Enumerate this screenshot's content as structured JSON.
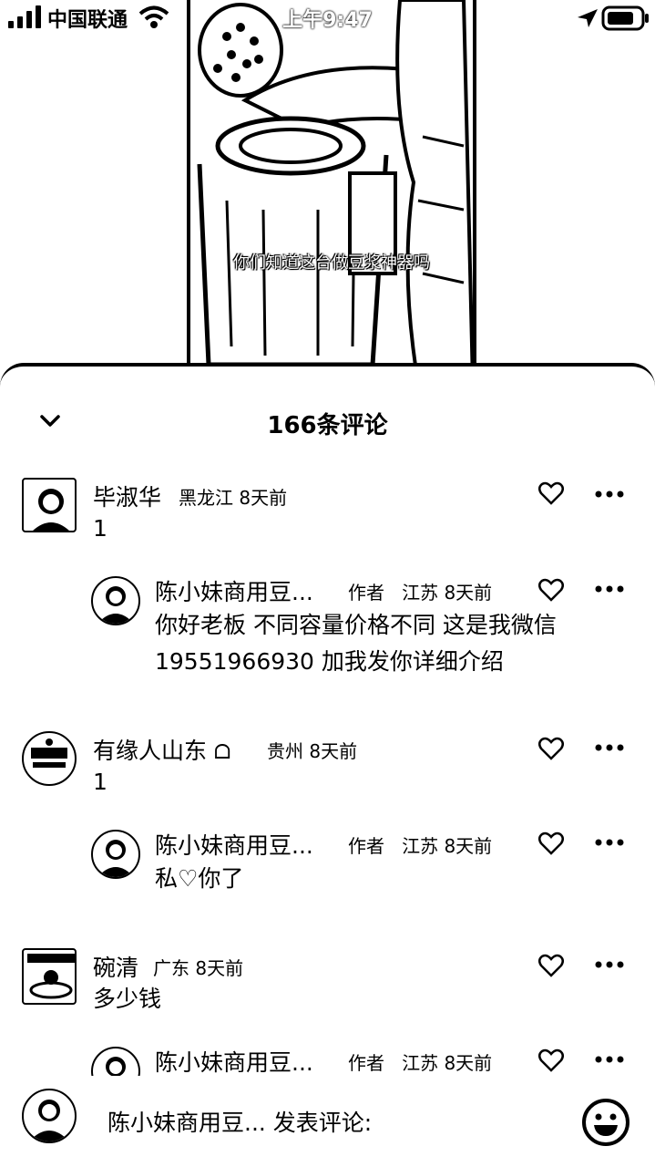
{
  "status_bar": {
    "carrier": "中国联通",
    "time": "上午9:47"
  },
  "video": {
    "caption": "你们知道这台做豆浆神器吗"
  },
  "sheet": {
    "title": "166条评论"
  },
  "comments": [
    {
      "name": "毕淑华",
      "location": "黑龙江",
      "time": "8天前",
      "text": "1",
      "reply": {
        "name": "陈小妹商用豆...",
        "tag": "作者",
        "location": "江苏",
        "time": "8天前",
        "text": "你好老板 不同容量价格不同 这是我微信\n19551966930  加我发你详细介绍"
      }
    },
    {
      "name": "有缘人山东",
      "badge": "ᗝ",
      "location": "贵州",
      "time": "8天前",
      "text": "1",
      "reply": {
        "name": "陈小妹商用豆...",
        "tag": "作者",
        "location": "江苏",
        "time": "8天前",
        "text": "私♡你了"
      }
    },
    {
      "name": "碗清",
      "location": "广东",
      "time": "8天前",
      "text": "多少钱",
      "reply": {
        "name": "陈小妹商用豆...",
        "tag": "作者",
        "location": "江苏",
        "time": "8天前"
      }
    }
  ],
  "composer": {
    "placeholder": "陈小妹商用豆... 发表评论:"
  },
  "icons": {
    "collapse": "chevron-down-icon",
    "like": "heart-outline-icon",
    "more": "more-horizontal-icon",
    "emoji": "emoji-icon"
  }
}
